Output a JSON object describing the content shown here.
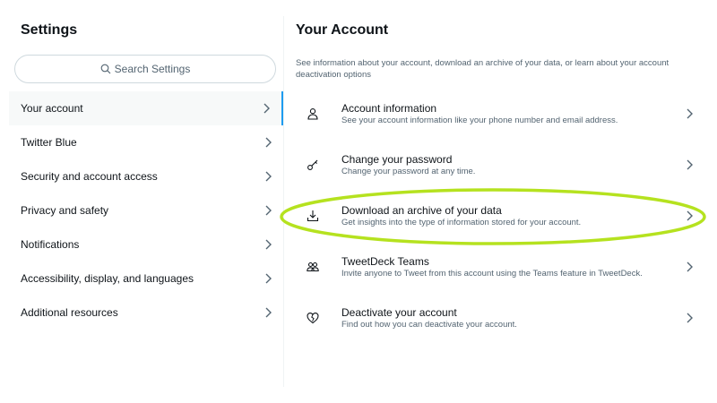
{
  "settings": {
    "title": "Settings",
    "search_placeholder": "Search Settings",
    "nav": [
      {
        "label": "Your account"
      },
      {
        "label": "Twitter Blue"
      },
      {
        "label": "Security and account access"
      },
      {
        "label": "Privacy and safety"
      },
      {
        "label": "Notifications"
      },
      {
        "label": "Accessibility, display, and languages"
      },
      {
        "label": "Additional resources"
      }
    ]
  },
  "account": {
    "title": "Your Account",
    "description": "See information about your account, download an archive of your data, or learn about your account deactivation options",
    "items": [
      {
        "title": "Account information",
        "subtitle": "See your account information like your phone number and email address.",
        "icon": "person-icon"
      },
      {
        "title": "Change your password",
        "subtitle": "Change your password at any time.",
        "icon": "key-icon"
      },
      {
        "title": "Download an archive of your data",
        "subtitle": "Get insights into the type of information stored for your account.",
        "icon": "download-icon"
      },
      {
        "title": "TweetDeck Teams",
        "subtitle": "Invite anyone to Tweet from this account using the Teams feature in TweetDeck.",
        "icon": "people-icon"
      },
      {
        "title": "Deactivate your account",
        "subtitle": "Find out how you can deactivate your account.",
        "icon": "broken-heart-icon"
      }
    ]
  },
  "colors": {
    "accent": "#1d9bf0",
    "highlight_ring": "#b5e21f",
    "muted": "#536471"
  }
}
